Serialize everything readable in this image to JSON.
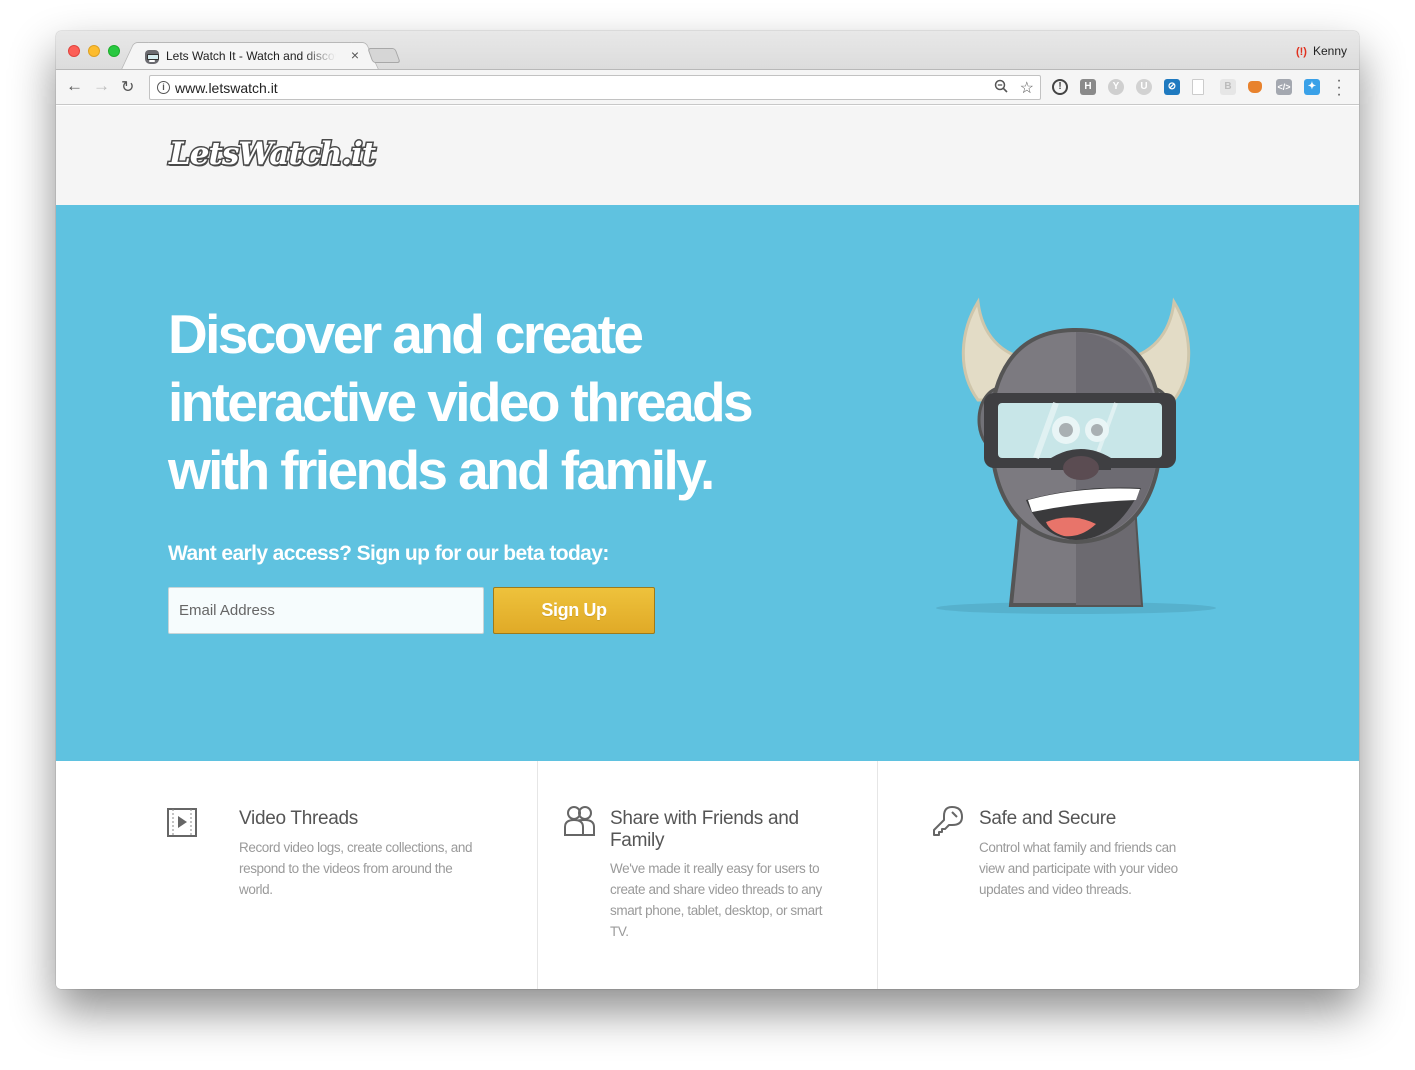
{
  "browser": {
    "tab_title": "Lets Watch It - Watch and discover",
    "tab_close": "×",
    "profile_name": "Kenny",
    "profile_icon": "(!)",
    "url": "www.letswatch.it",
    "nav": {
      "back": "←",
      "forward": "→",
      "reload": "↻"
    },
    "omnibox_icons": {
      "info": "i",
      "zoom": "🔍︎",
      "star": "☆"
    },
    "extensions": [
      {
        "name": "1password-icon",
        "glyph": "!"
      },
      {
        "name": "hacker-news-icon",
        "glyph": "H"
      },
      {
        "name": "yoast-icon",
        "glyph": "Y"
      },
      {
        "name": "ublock-icon",
        "glyph": "U"
      },
      {
        "name": "safari-compass-icon",
        "glyph": "⊘"
      },
      {
        "name": "blank-page-icon",
        "glyph": ""
      },
      {
        "name": "bitly-icon",
        "glyph": "B"
      },
      {
        "name": "metamask-fox-icon",
        "glyph": ""
      },
      {
        "name": "code-tag-icon",
        "glyph": "</>"
      },
      {
        "name": "twitter-dev-icon",
        "glyph": "✦"
      }
    ],
    "menu": "⋮"
  },
  "site": {
    "logo": "LetsWatch.it",
    "hero": {
      "headline": "Discover and create interactive video threads with friends and family.",
      "cta_label": "Want early access? Sign up for our beta today:",
      "email_placeholder": "Email Address",
      "signup_button": "Sign Up",
      "accent_color": "#5fc2e0",
      "button_color": "#e6b430"
    },
    "features": [
      {
        "icon": "film-play-icon",
        "title": "Video Threads",
        "description": "Record video logs, create collections, and respond to the videos from around the world."
      },
      {
        "icon": "users-icon",
        "title": "Share with Friends and Family",
        "description": "We've made it really easy for users to create and share video threads to any smart phone, tablet, desktop, or smart TV."
      },
      {
        "icon": "key-icon",
        "title": "Safe and Secure",
        "description": "Control what family and friends can view and participate with your video updates and video threads."
      }
    ]
  }
}
